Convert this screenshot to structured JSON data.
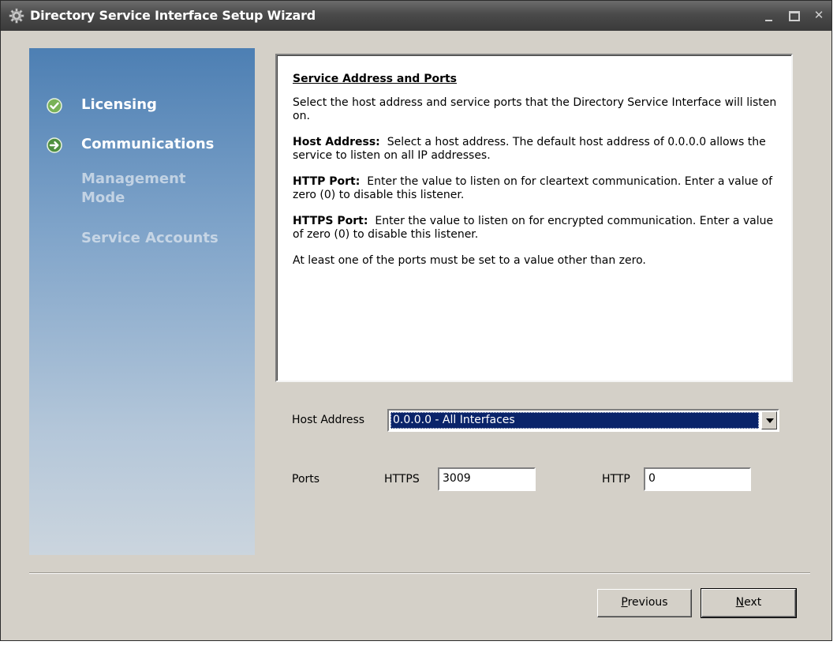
{
  "window": {
    "title": "Directory Service Interface Setup Wizard",
    "controls": [
      "minimize",
      "maximize",
      "close"
    ]
  },
  "sidebar": {
    "items": [
      {
        "label": "Licensing",
        "state": "complete",
        "icon": "check-circle-icon"
      },
      {
        "label": "Communications",
        "state": "current",
        "icon": "arrow-circle-icon"
      },
      {
        "label": "Management Mode",
        "state": "pending"
      },
      {
        "label": "Service Accounts",
        "state": "pending"
      }
    ],
    "colors": {
      "top": "#4d7fb3",
      "bottom": "#cbd5de",
      "check": "#6aa84f"
    }
  },
  "info": {
    "heading": "Service Address and Ports",
    "intro": "Select the host address and service ports that the Directory Service Interface will listen on.",
    "host_term": "Host Address:",
    "host_desc": "Select a host address.  The default host address of 0.0.0.0 allows the service to listen on all IP addresses.",
    "http_term": "HTTP Port:",
    "http_desc": "Enter the value to listen on for cleartext communication.  Enter a value of zero (0) to disable this listener.",
    "https_term": "HTTPS Port:",
    "https_desc": "Enter the value to listen on for encrypted communication.  Enter a value of zero (0) to disable this listener.",
    "note": "At least one of the ports must be set to a value other than zero."
  },
  "form": {
    "host_label": "Host Address",
    "host_value": "0.0.0.0 - All Interfaces",
    "ports_label": "Ports",
    "https_label": "HTTPS",
    "https_value": "3009",
    "http_label": "HTTP",
    "http_value": "0"
  },
  "buttons": {
    "previous": {
      "mnemonic": "P",
      "rest": "revious"
    },
    "next": {
      "mnemonic": "N",
      "rest": "ext"
    }
  }
}
